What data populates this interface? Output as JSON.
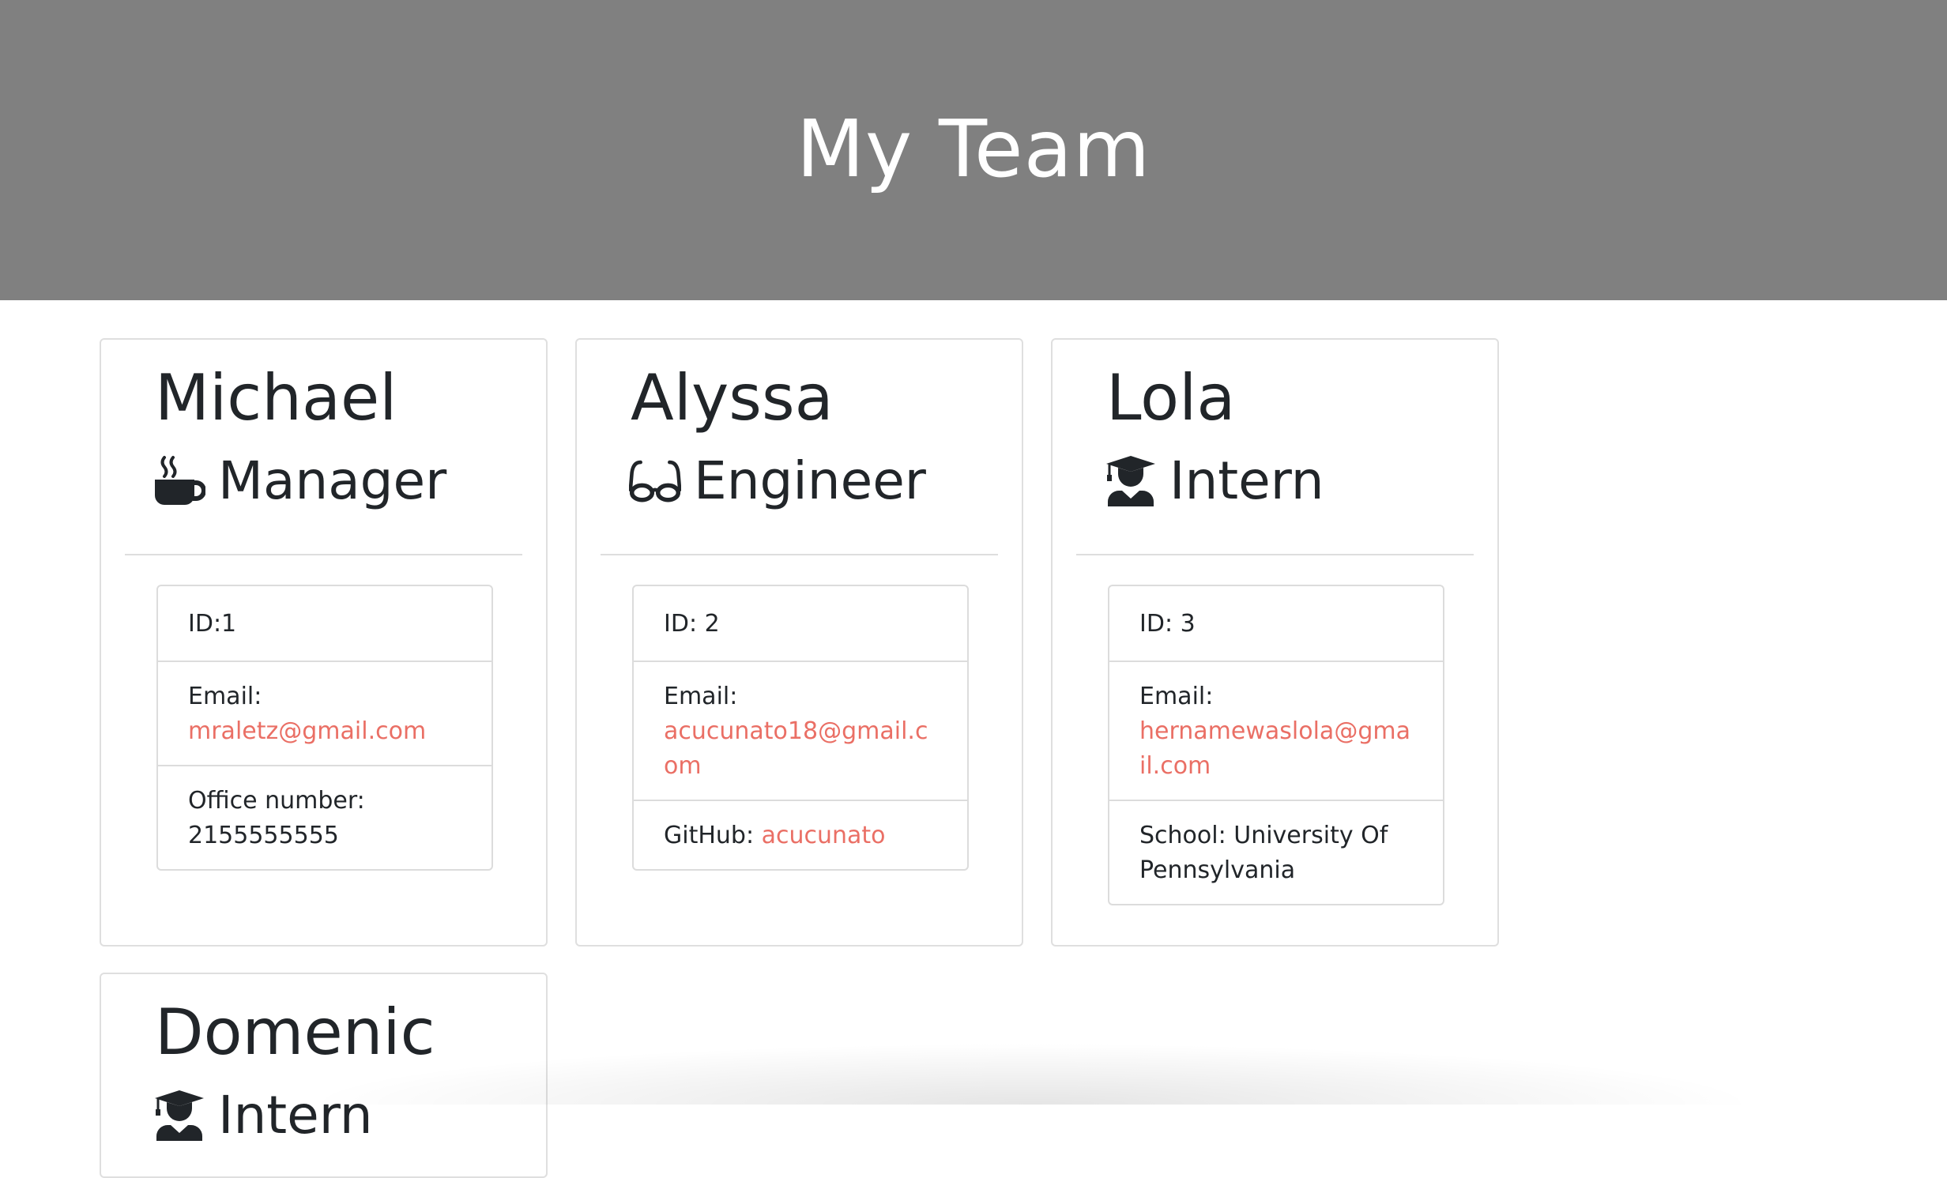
{
  "header": {
    "title": "My Team"
  },
  "theme": {
    "header_bg": "#808080",
    "link_color": "#ea6f65"
  },
  "employees": [
    {
      "name": "Michael",
      "role": "Manager",
      "icon": "coffee-mug-icon",
      "id_text": "ID:1",
      "email_label": "Email:",
      "email": "mraletz@gmail.com",
      "extra_label": "Office number:",
      "extra_value": "2155555555"
    },
    {
      "name": "Alyssa",
      "role": "Engineer",
      "icon": "glasses-icon",
      "id_text": "ID: 2",
      "email_label": "Email:",
      "email": "acucunato18@gmail.com",
      "extra_label": "GitHub:",
      "extra_value": "acucunato"
    },
    {
      "name": "Lola",
      "role": "Intern",
      "icon": "graduate-icon",
      "id_text": "ID: 3",
      "email_label": "Email:",
      "email": "hernamewaslola@gmail.com",
      "extra_label": "School:",
      "extra_value": "University Of Pennsylvania"
    },
    {
      "name": "Domenic",
      "role": "Intern",
      "icon": "graduate-icon"
    }
  ]
}
